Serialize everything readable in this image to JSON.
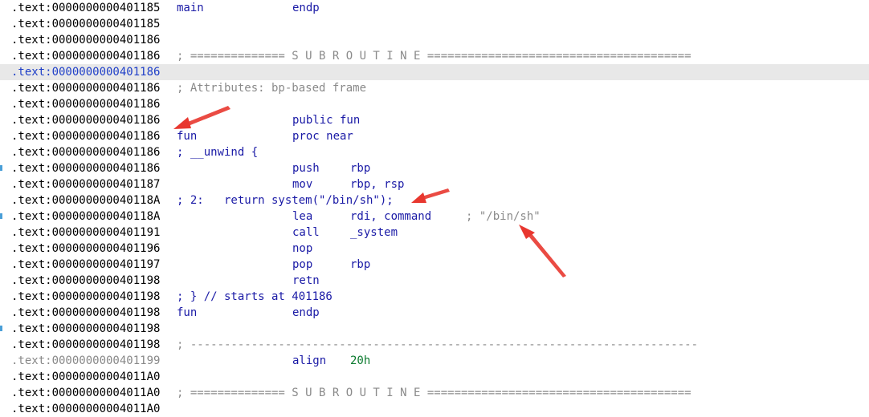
{
  "listing": {
    "rows": [
      {
        "addr": ".text:0000000000401185",
        "label": "main",
        "mnemonic": "endp"
      },
      {
        "addr": ".text:0000000000401185"
      },
      {
        "addr": ".text:0000000000401186"
      },
      {
        "addr": ".text:0000000000401186",
        "comment": "; ============== S U B R O U T I N E ======================================="
      },
      {
        "addr": ".text:0000000000401186",
        "highlight": true
      },
      {
        "addr": ".text:0000000000401186",
        "comment": "; Attributes: bp-based frame"
      },
      {
        "addr": ".text:0000000000401186"
      },
      {
        "addr": ".text:0000000000401186",
        "mnemonic": "public fun"
      },
      {
        "addr": ".text:0000000000401186",
        "label": "fun",
        "mnemonic": "proc near"
      },
      {
        "addr": ".text:0000000000401186",
        "comment_blue": "; __unwind {"
      },
      {
        "addr": ".text:0000000000401186",
        "mnemonic": "push",
        "operands": "rbp"
      },
      {
        "addr": ".text:0000000000401187",
        "mnemonic": "mov",
        "operands": "rbp, rsp"
      },
      {
        "addr": ".text:000000000040118A",
        "comment_blue": "; 2:   return system(\"/bin/sh\");"
      },
      {
        "addr": ".text:000000000040118A",
        "mnemonic": "lea",
        "operands": "rdi, command",
        "tail_comment": "; \"/bin/sh\""
      },
      {
        "addr": ".text:0000000000401191",
        "mnemonic": "call",
        "operands": "_system"
      },
      {
        "addr": ".text:0000000000401196",
        "mnemonic": "nop"
      },
      {
        "addr": ".text:0000000000401197",
        "mnemonic": "pop",
        "operands": "rbp"
      },
      {
        "addr": ".text:0000000000401198",
        "mnemonic": "retn"
      },
      {
        "addr": ".text:0000000000401198",
        "comment_blue": "; } // starts at 401186"
      },
      {
        "addr": ".text:0000000000401198",
        "label": "fun",
        "mnemonic": "endp"
      },
      {
        "addr": ".text:0000000000401198"
      },
      {
        "addr": ".text:0000000000401198",
        "comment": "; ---------------------------------------------------------------------------"
      },
      {
        "addr": ".text:0000000000401199",
        "addr_grey": true,
        "mnemonic": "align",
        "operands_num": "20h"
      },
      {
        "addr": ".text:00000000004011A0"
      },
      {
        "addr": ".text:00000000004011A0",
        "comment": "; ============== S U B R O U T I N E ======================================="
      },
      {
        "addr": ".text:00000000004011A0"
      }
    ]
  },
  "colors": {
    "address": "#000000",
    "keyword_blue": "#1a1aa6",
    "comment_grey": "#8a8a8a",
    "number_green": "#0b7a2e",
    "highlight_row": "#e8e8e8",
    "annotation_arrow": "#e8372f",
    "gutter_marker": "#4a9fd8"
  },
  "gutter_markers_at_rows": [
    10,
    13,
    20
  ]
}
